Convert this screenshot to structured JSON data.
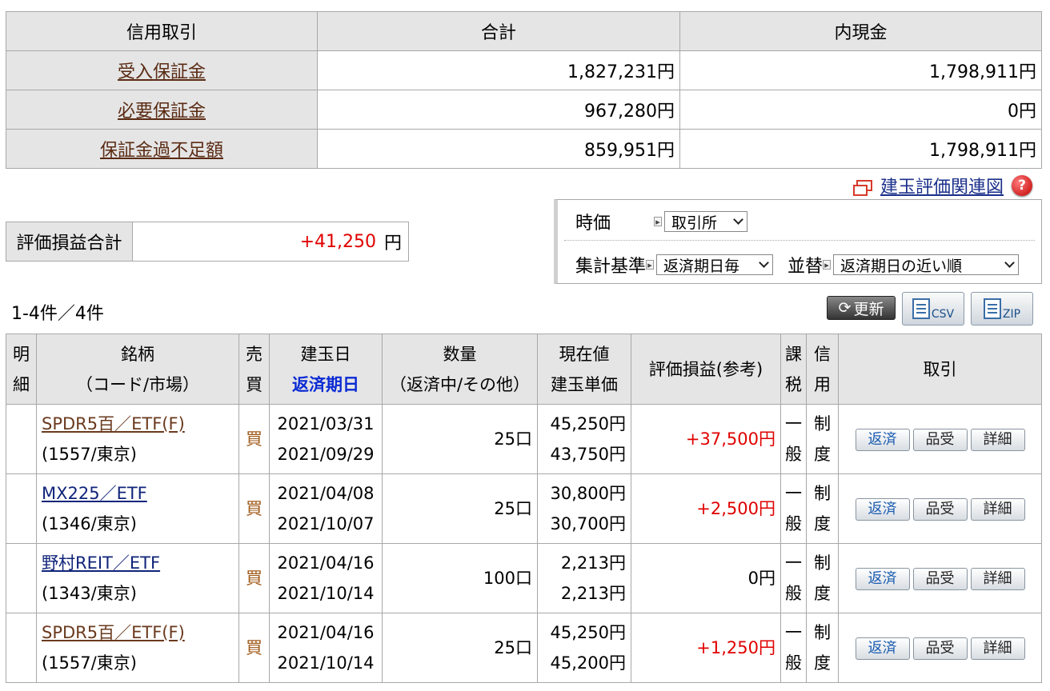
{
  "summary": {
    "headers": [
      "信用取引",
      "合計",
      "内現金"
    ],
    "rows": [
      {
        "label": "受入保証金",
        "total": "1,827,231円",
        "cash": "1,798,911円"
      },
      {
        "label": "必要保証金",
        "total": "967,280円",
        "cash": "0円"
      },
      {
        "label": "保証金過不足額",
        "total": "859,951円",
        "cash": "1,798,911円"
      }
    ]
  },
  "chart_link": "建玉評価関連図",
  "pl_total": {
    "label": "評価損益合計",
    "value": "+41,250",
    "unit": "円"
  },
  "filters": {
    "price_label": "時価",
    "price_value": "取引所",
    "agg_label": "集計基準",
    "agg_value": "返済期日毎",
    "sort_label": "並替",
    "sort_value": "返済期日の近い順"
  },
  "count_text": "1-4件／4件",
  "toolbar": {
    "refresh": "更新",
    "csv": "CSV",
    "zip": "ZIP"
  },
  "table": {
    "headers": {
      "detail": "明細",
      "name1": "銘柄",
      "name2": "（コード/市場）",
      "side": "売買",
      "date1": "建玉日",
      "date2": "返済期日",
      "qty1": "数量",
      "qty2": "（返済中/その他）",
      "price1": "現在値",
      "price2": "建玉単価",
      "pl": "評価損益(参考)",
      "tax": "課税",
      "credit": "信用",
      "trade": "取引"
    },
    "rows": [
      {
        "name": "SPDR5百／ETF(F)",
        "code": "(1557/東京)",
        "side": "買",
        "open_date": "2021/03/31",
        "due_date": "2021/09/29",
        "qty": "25口",
        "price": "45,250円",
        "cost": "43,750円",
        "pl": "+37,500円",
        "tax": "一般",
        "credit": "制度"
      },
      {
        "name": "MX225／ETF",
        "code": "(1346/東京)",
        "side": "買",
        "open_date": "2021/04/08",
        "due_date": "2021/10/07",
        "qty": "25口",
        "price": "30,800円",
        "cost": "30,700円",
        "pl": "+2,500円",
        "tax": "一般",
        "credit": "制度"
      },
      {
        "name": "野村REIT／ETF",
        "code": "(1343/東京)",
        "side": "買",
        "open_date": "2021/04/16",
        "due_date": "2021/10/14",
        "qty": "100口",
        "price": "2,213円",
        "cost": "2,213円",
        "pl": "0円",
        "tax": "一般",
        "credit": "制度"
      },
      {
        "name": "SPDR5百／ETF(F)",
        "code": "(1557/東京)",
        "side": "買",
        "open_date": "2021/04/16",
        "due_date": "2021/10/14",
        "qty": "25口",
        "price": "45,250円",
        "cost": "45,200円",
        "pl": "+1,250円",
        "tax": "一般",
        "credit": "制度"
      }
    ],
    "actions": {
      "repay": "返済",
      "delivery": "品受",
      "detail": "詳細"
    }
  }
}
